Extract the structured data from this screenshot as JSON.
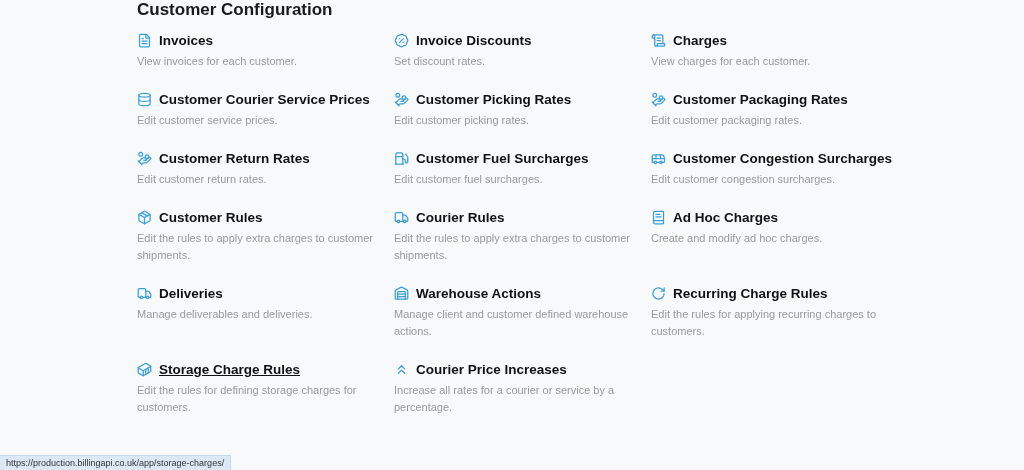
{
  "section": {
    "title": "Customer Configuration"
  },
  "items": [
    {
      "kind": "document",
      "title": "Invoices",
      "description": "View invoices for each customer.",
      "hovered": false
    },
    {
      "kind": "percent",
      "title": "Invoice Discounts",
      "description": "Set discount rates.",
      "hovered": false
    },
    {
      "kind": "list",
      "title": "Charges",
      "description": "View charges for each customer.",
      "hovered": false
    },
    {
      "kind": "coins",
      "title": "Customer Courier Service Prices",
      "description": "Edit customer service prices.",
      "hovered": false
    },
    {
      "kind": "rates",
      "title": "Customer Picking Rates",
      "description": "Edit customer picking rates.",
      "hovered": false
    },
    {
      "kind": "rates",
      "title": "Customer Packaging Rates",
      "description": "Edit customer packaging rates.",
      "hovered": false
    },
    {
      "kind": "rates",
      "title": "Customer Return Rates",
      "description": "Edit customer return rates.",
      "hovered": false
    },
    {
      "kind": "fuel",
      "title": "Customer Fuel Surcharges",
      "description": "Edit customer fuel surcharges.",
      "hovered": false
    },
    {
      "kind": "car",
      "title": "Customer Congestion Surcharges",
      "description": "Edit customer congestion surcharges.",
      "hovered": false
    },
    {
      "kind": "box",
      "title": "Customer Rules",
      "description": "Edit the rules to apply extra charges to customer shipments.",
      "hovered": false
    },
    {
      "kind": "truck",
      "title": "Courier Rules",
      "description": "Edit the rules to apply extra charges to customer shipments.",
      "hovered": false
    },
    {
      "kind": "book",
      "title": "Ad Hoc Charges",
      "description": "Create and modify ad hoc charges.",
      "hovered": false
    },
    {
      "kind": "truck",
      "title": "Deliveries",
      "description": "Manage deliverables and deliveries.",
      "hovered": false
    },
    {
      "kind": "warehouse",
      "title": "Warehouse Actions",
      "description": "Manage client and customer defined warehouse actions.",
      "hovered": false
    },
    {
      "kind": "refresh",
      "title": "Recurring Charge Rules",
      "description": "Edit the rules for applying recurring charges to customers.",
      "hovered": false
    },
    {
      "kind": "storage",
      "title": "Storage Charge Rules",
      "description": "Edit the rules for defining storage charges for customers.",
      "hovered": true
    },
    {
      "kind": "chevrons",
      "title": "Courier Price Increases",
      "description": "Increase all rates for a courier or service by a percentage.",
      "hovered": false
    }
  ],
  "status_bar": {
    "url": "https://production.billingapi.co.uk/app/storage-charges/"
  }
}
